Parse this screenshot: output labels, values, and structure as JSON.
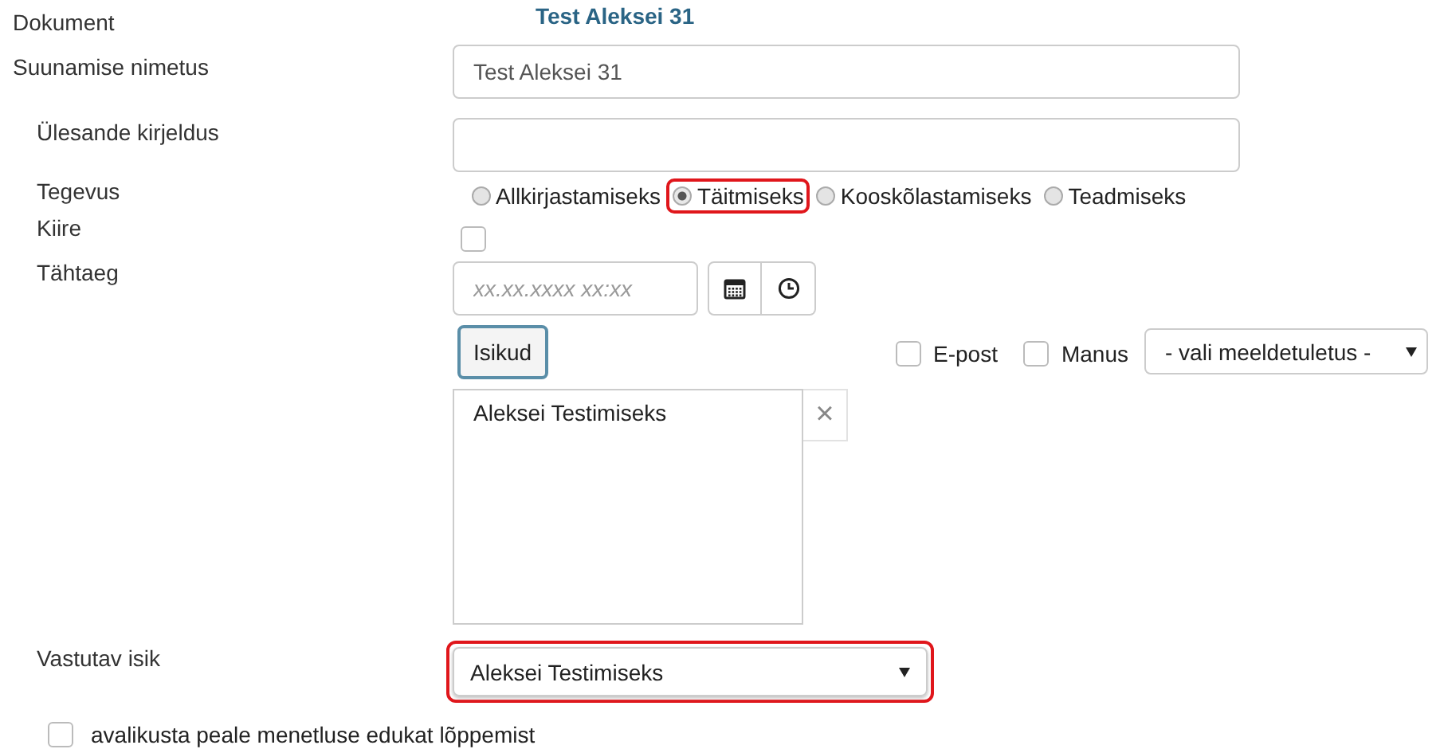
{
  "document": {
    "label": "Dokument",
    "value": "Test Aleksei 31"
  },
  "name_field": {
    "label": "Suunamise nimetus",
    "value": "Test Aleksei 31"
  },
  "description_field": {
    "label": "Ülesande kirjeldus"
  },
  "action": {
    "label": "Tegevus",
    "options": [
      {
        "label": "Allkirjastamiseks",
        "selected": false,
        "highlighted": false
      },
      {
        "label": "Täitmiseks",
        "selected": true,
        "highlighted": true
      },
      {
        "label": "Kooskõlastamiseks",
        "selected": false,
        "highlighted": false
      },
      {
        "label": "Teadmiseks",
        "selected": false,
        "highlighted": false
      }
    ]
  },
  "urgent": {
    "label": "Kiire",
    "checked": false
  },
  "deadline": {
    "label": "Tähtaeg",
    "placeholder": "xx.xx.xxxx xx:xx"
  },
  "persons_button": "Isikud",
  "email": {
    "label": "E-post",
    "checked": false
  },
  "attachment": {
    "label": "Manus",
    "checked": false
  },
  "reminder_select": {
    "value": "- vali meeldetuletus -"
  },
  "persons": [
    "Aleksei Testimiseks"
  ],
  "remove_button": "×",
  "responsible": {
    "label": "Vastutav isik",
    "value": "Aleksei Testimiseks",
    "highlighted": true
  },
  "publish": {
    "label": "avalikusta peale menetluse edukat lõppemist",
    "checked": false
  }
}
